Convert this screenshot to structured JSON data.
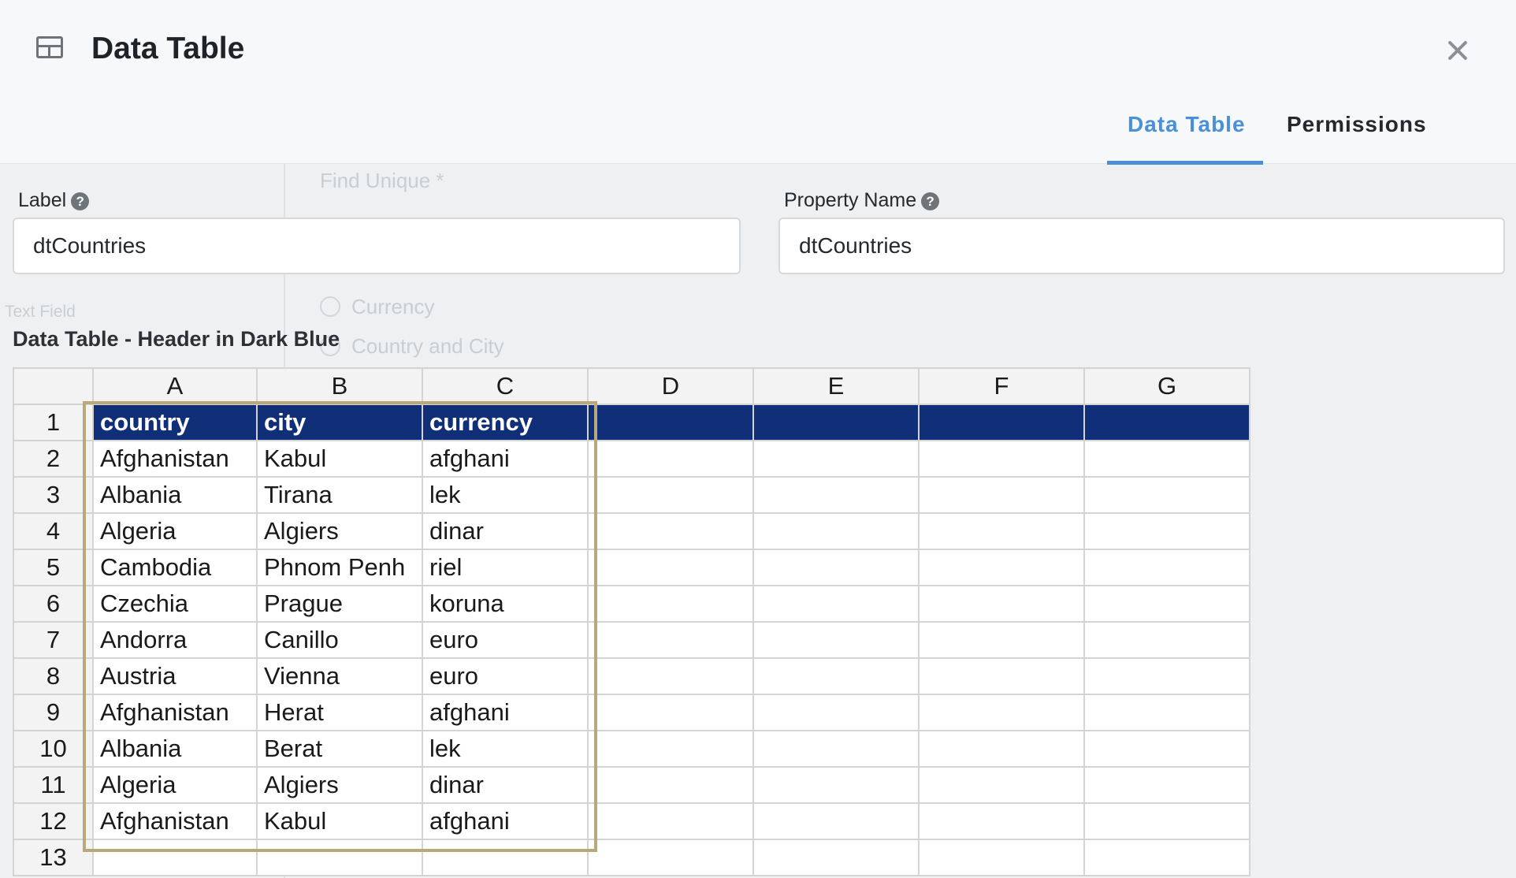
{
  "header": {
    "icon": "table-icon",
    "title": "Data Table",
    "close_icon": "close-icon"
  },
  "tabs": [
    {
      "label": "Data Table",
      "active": true
    },
    {
      "label": "Permissions",
      "active": false
    }
  ],
  "form": {
    "label_field": {
      "label": "Label",
      "value": "dtCountries"
    },
    "property_name_field": {
      "label": "Property Name",
      "value": "dtCountries"
    }
  },
  "background_page": {
    "find_unique_label": "Find Unique *",
    "radio_currency": "Currency",
    "radio_country_city": "Country and City",
    "text_field_label": "Text Field"
  },
  "table": {
    "title": "Data Table - Header in Dark Blue",
    "header_color": "#102f78",
    "columns": [
      "A",
      "B",
      "C",
      "D",
      "E",
      "F",
      "G"
    ],
    "rows": [
      {
        "num": "1",
        "cells": [
          "country",
          "city",
          "currency",
          "",
          "",
          "",
          ""
        ]
      },
      {
        "num": "2",
        "cells": [
          "Afghanistan",
          "Kabul",
          "afghani",
          "",
          "",
          "",
          ""
        ]
      },
      {
        "num": "3",
        "cells": [
          "Albania",
          "Tirana",
          "lek",
          "",
          "",
          "",
          ""
        ]
      },
      {
        "num": "4",
        "cells": [
          "Algeria",
          "Algiers",
          "dinar",
          "",
          "",
          "",
          ""
        ]
      },
      {
        "num": "5",
        "cells": [
          "Cambodia",
          "Phnom Penh",
          "riel",
          "",
          "",
          "",
          ""
        ]
      },
      {
        "num": "6",
        "cells": [
          "Czechia",
          "Prague",
          "koruna",
          "",
          "",
          "",
          ""
        ]
      },
      {
        "num": "7",
        "cells": [
          "Andorra",
          "Canillo",
          "euro",
          "",
          "",
          "",
          ""
        ]
      },
      {
        "num": "8",
        "cells": [
          "Austria",
          "Vienna",
          "euro",
          "",
          "",
          "",
          ""
        ]
      },
      {
        "num": "9",
        "cells": [
          "Afghanistan",
          "Herat",
          "afghani",
          "",
          "",
          "",
          ""
        ]
      },
      {
        "num": "10",
        "cells": [
          "Albania",
          "Berat",
          "lek",
          "",
          "",
          "",
          ""
        ]
      },
      {
        "num": "11",
        "cells": [
          "Algeria",
          "Algiers",
          "dinar",
          "",
          "",
          "",
          ""
        ]
      },
      {
        "num": "12",
        "cells": [
          "Afghanistan",
          "Kabul",
          "afghani",
          "",
          "",
          "",
          ""
        ]
      },
      {
        "num": "13",
        "cells": [
          "",
          "",
          "",
          "",
          "",
          "",
          ""
        ]
      }
    ]
  }
}
